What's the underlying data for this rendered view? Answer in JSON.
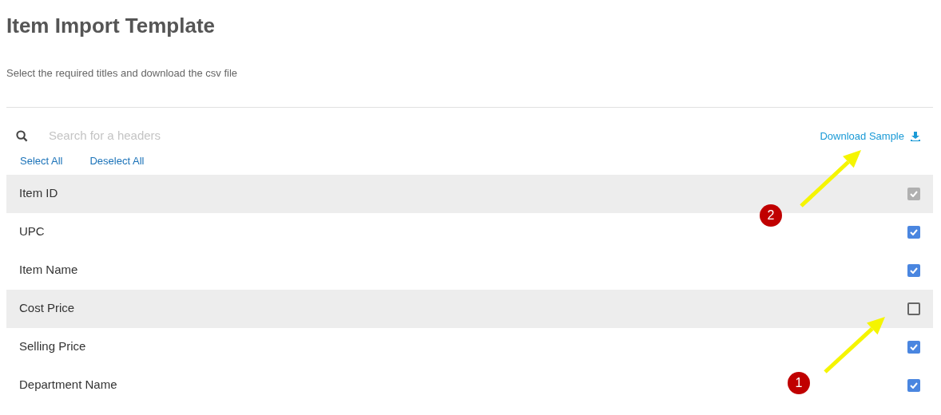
{
  "title": "Item Import Template",
  "subtitle": "Select the required titles and download the csv file",
  "search": {
    "placeholder": "Search for a headers"
  },
  "download": {
    "label": "Download Sample"
  },
  "links": [
    "Select All",
    "Deselect All"
  ],
  "rows": [
    {
      "label": "Item ID",
      "checked": true,
      "disabled": true,
      "highlighted": true
    },
    {
      "label": "UPC",
      "checked": true,
      "disabled": false,
      "highlighted": false
    },
    {
      "label": "Item Name",
      "checked": true,
      "disabled": false,
      "highlighted": false
    },
    {
      "label": "Cost Price",
      "checked": false,
      "disabled": false,
      "highlighted": true
    },
    {
      "label": "Selling Price",
      "checked": true,
      "disabled": false,
      "highlighted": false
    },
    {
      "label": "Department Name",
      "checked": true,
      "disabled": false,
      "highlighted": false
    }
  ],
  "annotations": [
    {
      "number": "2"
    },
    {
      "number": "1"
    }
  ]
}
